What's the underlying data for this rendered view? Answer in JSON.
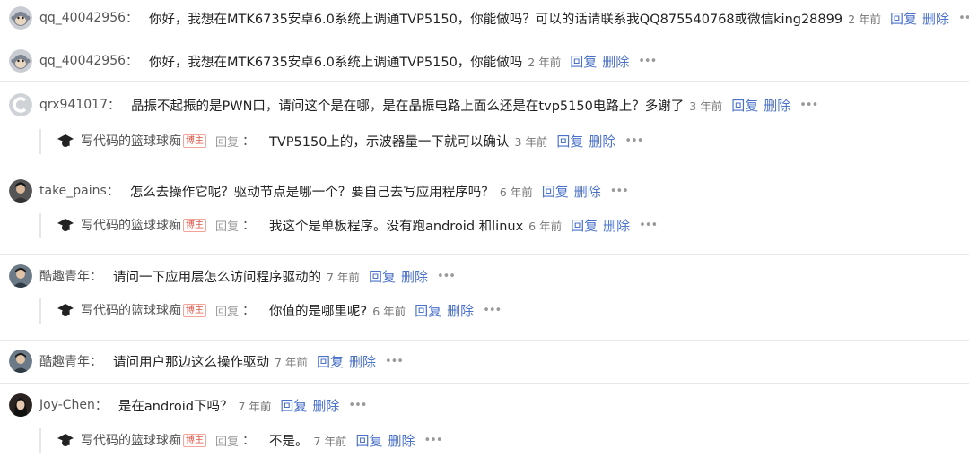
{
  "comments": [
    {
      "user": "qq_40042956",
      "text": "你好，我想在MTK6735安卓6.0系统上调通TVP5150，你能做吗？可以的话请联系我QQ875540768或微信king28899",
      "time": "2 年前",
      "reply_label": "回复",
      "delete_label": "删除",
      "more": "•••",
      "avatar_icon": "monkey-avatar-icon"
    },
    {
      "user": "qq_40042956",
      "text": "你好，我想在MTK6735安卓6.0系统上调通TVP5150，你能做吗",
      "time": "2 年前",
      "reply_label": "回复",
      "delete_label": "删除",
      "more": "•••",
      "avatar_icon": "monkey-avatar-icon"
    },
    {
      "user": "qrx941017",
      "text": "晶振不起振的是PWN口，请问这个是在哪，是在晶振电路上面么还是在tvp5150电路上？多谢了",
      "time": "3 年前",
      "reply_label": "回复",
      "delete_label": "删除",
      "more": "•••",
      "avatar_icon": "c-logo-avatar-icon",
      "reply": {
        "user": "写代码的篮球球痴",
        "badge": "博主",
        "reply_word": "回复",
        "text": "TVP5150上的，示波器量一下就可以确认",
        "time": "3 年前",
        "reply_label": "回复",
        "delete_label": "删除",
        "more": "•••"
      }
    },
    {
      "user": "take_pains",
      "text": "怎么去操作它呢？驱动节点是哪一个？要自己去写应用程序吗？",
      "time": "6 年前",
      "reply_label": "回复",
      "delete_label": "删除",
      "more": "•••",
      "avatar_icon": "person-avatar-icon",
      "reply": {
        "user": "写代码的篮球球痴",
        "badge": "博主",
        "reply_word": "回复",
        "text": "我这个是单板程序。没有跑android 和linux",
        "time": "6 年前",
        "reply_label": "回复",
        "delete_label": "删除",
        "more": "•••"
      }
    },
    {
      "user": "酷趣青年",
      "text": "请问一下应用层怎么访问程序驱动的",
      "time": "7 年前",
      "reply_label": "回复",
      "delete_label": "删除",
      "more": "•••",
      "avatar_icon": "person-avatar-icon",
      "reply": {
        "user": "写代码的篮球球痴",
        "badge": "博主",
        "reply_word": "回复",
        "text": "你值的是哪里呢?",
        "time": "6 年前",
        "reply_label": "回复",
        "delete_label": "删除",
        "more": "•••"
      }
    },
    {
      "user": "酷趣青年",
      "text": "请问用户那边这么操作驱动",
      "time": "7 年前",
      "reply_label": "回复",
      "delete_label": "删除",
      "more": "•••",
      "avatar_icon": "person-avatar-icon"
    },
    {
      "user": "Joy-Chen",
      "text": "是在android下吗？",
      "time": "7 年前",
      "reply_label": "回复",
      "delete_label": "删除",
      "more": "•••",
      "avatar_icon": "person-avatar-icon",
      "reply": {
        "user": "写代码的篮球球痴",
        "badge": "博主",
        "reply_word": "回复",
        "text": "不是。",
        "time": "7 年前",
        "reply_label": "回复",
        "delete_label": "删除",
        "more": "•••"
      }
    }
  ],
  "colors": {
    "link": "#4b72c9",
    "muted": "#777777",
    "badge": "#e0574a",
    "separator": "#e8e8e8"
  }
}
